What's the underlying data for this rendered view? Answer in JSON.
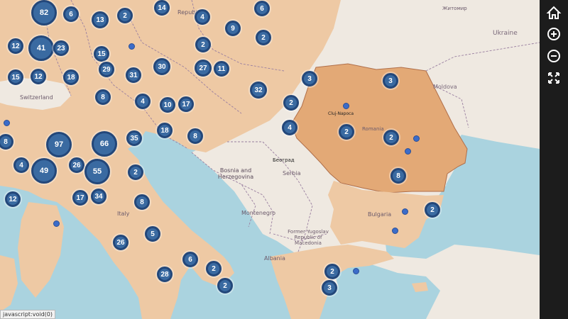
{
  "map": {
    "places": [
      {
        "name": "Ukraine"
      },
      {
        "name": "Moldova"
      },
      {
        "name": "Switzerland"
      },
      {
        "name": "Romania"
      },
      {
        "name": "Bosnia and Herzegovina"
      },
      {
        "name": "Serbia"
      },
      {
        "name": "Montenegro"
      },
      {
        "name": "Bulgaria"
      },
      {
        "name": "Former Yugoslav Republic of Macedonia"
      },
      {
        "name": "Albania"
      },
      {
        "name": "Italy"
      },
      {
        "name": "Београд"
      },
      {
        "name": "Cluj-Napoca"
      },
      {
        "name": "Republik"
      },
      {
        "name": "Житомир"
      }
    ],
    "clusters": [
      {
        "count": "82"
      },
      {
        "count": "6"
      },
      {
        "count": "13"
      },
      {
        "count": "2"
      },
      {
        "count": "14"
      },
      {
        "count": "4"
      },
      {
        "count": "6"
      },
      {
        "count": "9"
      },
      {
        "count": "2"
      },
      {
        "count": "12"
      },
      {
        "count": "41"
      },
      {
        "count": "23"
      },
      {
        "count": "15"
      },
      {
        "count": "2"
      },
      {
        "count": "15"
      },
      {
        "count": "12"
      },
      {
        "count": "18"
      },
      {
        "count": "29"
      },
      {
        "count": "31"
      },
      {
        "count": "30"
      },
      {
        "count": "27"
      },
      {
        "count": "11"
      },
      {
        "count": "3"
      },
      {
        "count": "3"
      },
      {
        "count": "32"
      },
      {
        "count": "8"
      },
      {
        "count": "4"
      },
      {
        "count": "10"
      },
      {
        "count": "17"
      },
      {
        "count": "2"
      },
      {
        "count": "2"
      },
      {
        "count": "8"
      },
      {
        "count": "97"
      },
      {
        "count": "66"
      },
      {
        "count": "35"
      },
      {
        "count": "18"
      },
      {
        "count": "8"
      },
      {
        "count": "4"
      },
      {
        "count": "2"
      },
      {
        "count": "4"
      },
      {
        "count": "49"
      },
      {
        "count": "26"
      },
      {
        "count": "55"
      },
      {
        "count": "2"
      },
      {
        "count": "8"
      },
      {
        "count": "12"
      },
      {
        "count": "17"
      },
      {
        "count": "34"
      },
      {
        "count": "8"
      },
      {
        "count": "2"
      },
      {
        "count": "5"
      },
      {
        "count": "26"
      },
      {
        "count": "6"
      },
      {
        "count": "2"
      },
      {
        "count": "28"
      },
      {
        "count": "2"
      },
      {
        "count": "2"
      },
      {
        "count": "3"
      }
    ]
  },
  "toolbar": {
    "home_icon": "home-icon",
    "zoom_in_icon": "zoom-in-icon",
    "zoom_out_icon": "zoom-out-icon",
    "fullscreen_icon": "fullscreen-icon"
  },
  "status_text": "javascript:void(0)",
  "colors": {
    "sea": "#aad3df",
    "land": "#efe9e1",
    "highlight_country": "#e3a976",
    "highlight_region": "#eec9a4",
    "marker": "#3a6aa1"
  }
}
